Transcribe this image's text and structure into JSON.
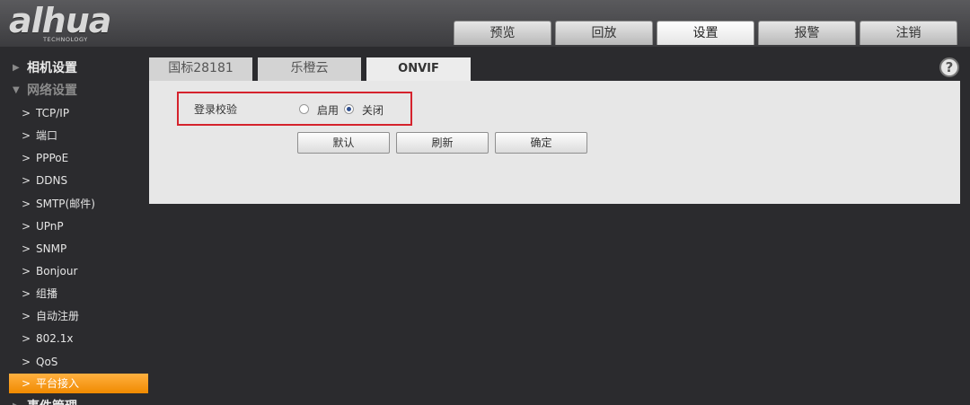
{
  "logo": {
    "brand": "alhua",
    "sub": "TECHNOLOGY"
  },
  "main_tabs": [
    {
      "label": "预览"
    },
    {
      "label": "回放"
    },
    {
      "label": "设置"
    },
    {
      "label": "报警"
    },
    {
      "label": "注销"
    }
  ],
  "sidebar": {
    "group_camera": "相机设置",
    "group_network": "网络设置",
    "items": [
      {
        "label": "TCP/IP"
      },
      {
        "label": "端口"
      },
      {
        "label": "PPPoE"
      },
      {
        "label": "DDNS"
      },
      {
        "label": "SMTP(邮件)"
      },
      {
        "label": "UPnP"
      },
      {
        "label": "SNMP"
      },
      {
        "label": "Bonjour"
      },
      {
        "label": "组播"
      },
      {
        "label": "自动注册"
      },
      {
        "label": "802.1x"
      },
      {
        "label": "QoS"
      },
      {
        "label": "平台接入"
      }
    ],
    "group_event": "事件管理"
  },
  "sub_tabs": [
    {
      "label": "国标28181"
    },
    {
      "label": "乐橙云"
    },
    {
      "label": "ONVIF"
    }
  ],
  "help": "?",
  "form": {
    "login_label": "登录校验",
    "option_enable": "启用",
    "option_disable": "关闭",
    "selected": "关闭"
  },
  "buttons": {
    "default": "默认",
    "refresh": "刷新",
    "confirm": "确定"
  },
  "colors": {
    "accent": "#f08a00",
    "highlight_border": "#d5232d"
  }
}
